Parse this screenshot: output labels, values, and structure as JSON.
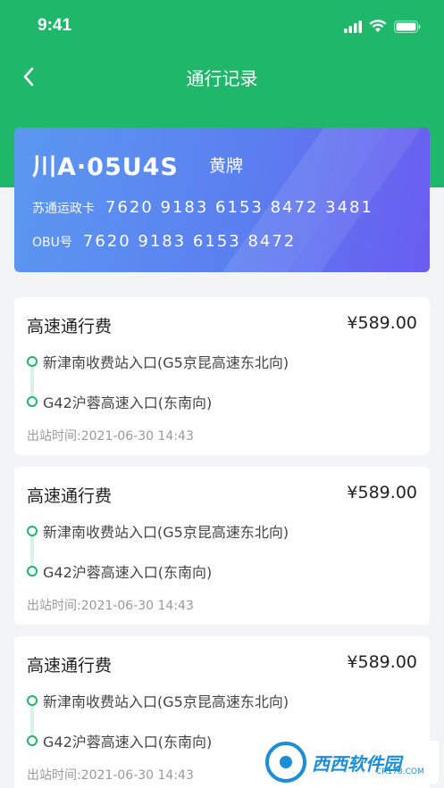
{
  "status_bar": {
    "time": "9:41"
  },
  "nav": {
    "title": "通行记录"
  },
  "vehicle_card": {
    "plate": "川A·05U4S",
    "plate_color": "黄牌",
    "card_label": "苏通运政卡",
    "card_number": "7620 9183 6153 8472 3481",
    "obu_label": "OBU号",
    "obu_number": "7620 9183 6153 8472"
  },
  "records": [
    {
      "title": "高速通行费",
      "amount": "¥589.00",
      "entry": "新津南收费站入口(G5京昆高速东北向)",
      "exit": "G42沪蓉高速入口(东南向)",
      "time": "出站时间:2021-06-30 14:43"
    },
    {
      "title": "高速通行费",
      "amount": "¥589.00",
      "entry": "新津南收费站入口(G5京昆高速东北向)",
      "exit": "G42沪蓉高速入口(东南向)",
      "time": "出站时间:2021-06-30 14:43"
    },
    {
      "title": "高速通行费",
      "amount": "¥589.00",
      "entry": "新津南收费站入口(G5京昆高速东北向)",
      "exit": "G42沪蓉高速入口(东南向)",
      "time": "出站时间:2021-06-30 14:43"
    }
  ],
  "watermark": {
    "text": "西西软件园",
    "sub": "CR173.COM"
  },
  "colors": {
    "brand_green": "#1fb769",
    "card_gradient_start": "#5b98f0",
    "card_gradient_end": "#6a5cf0"
  }
}
